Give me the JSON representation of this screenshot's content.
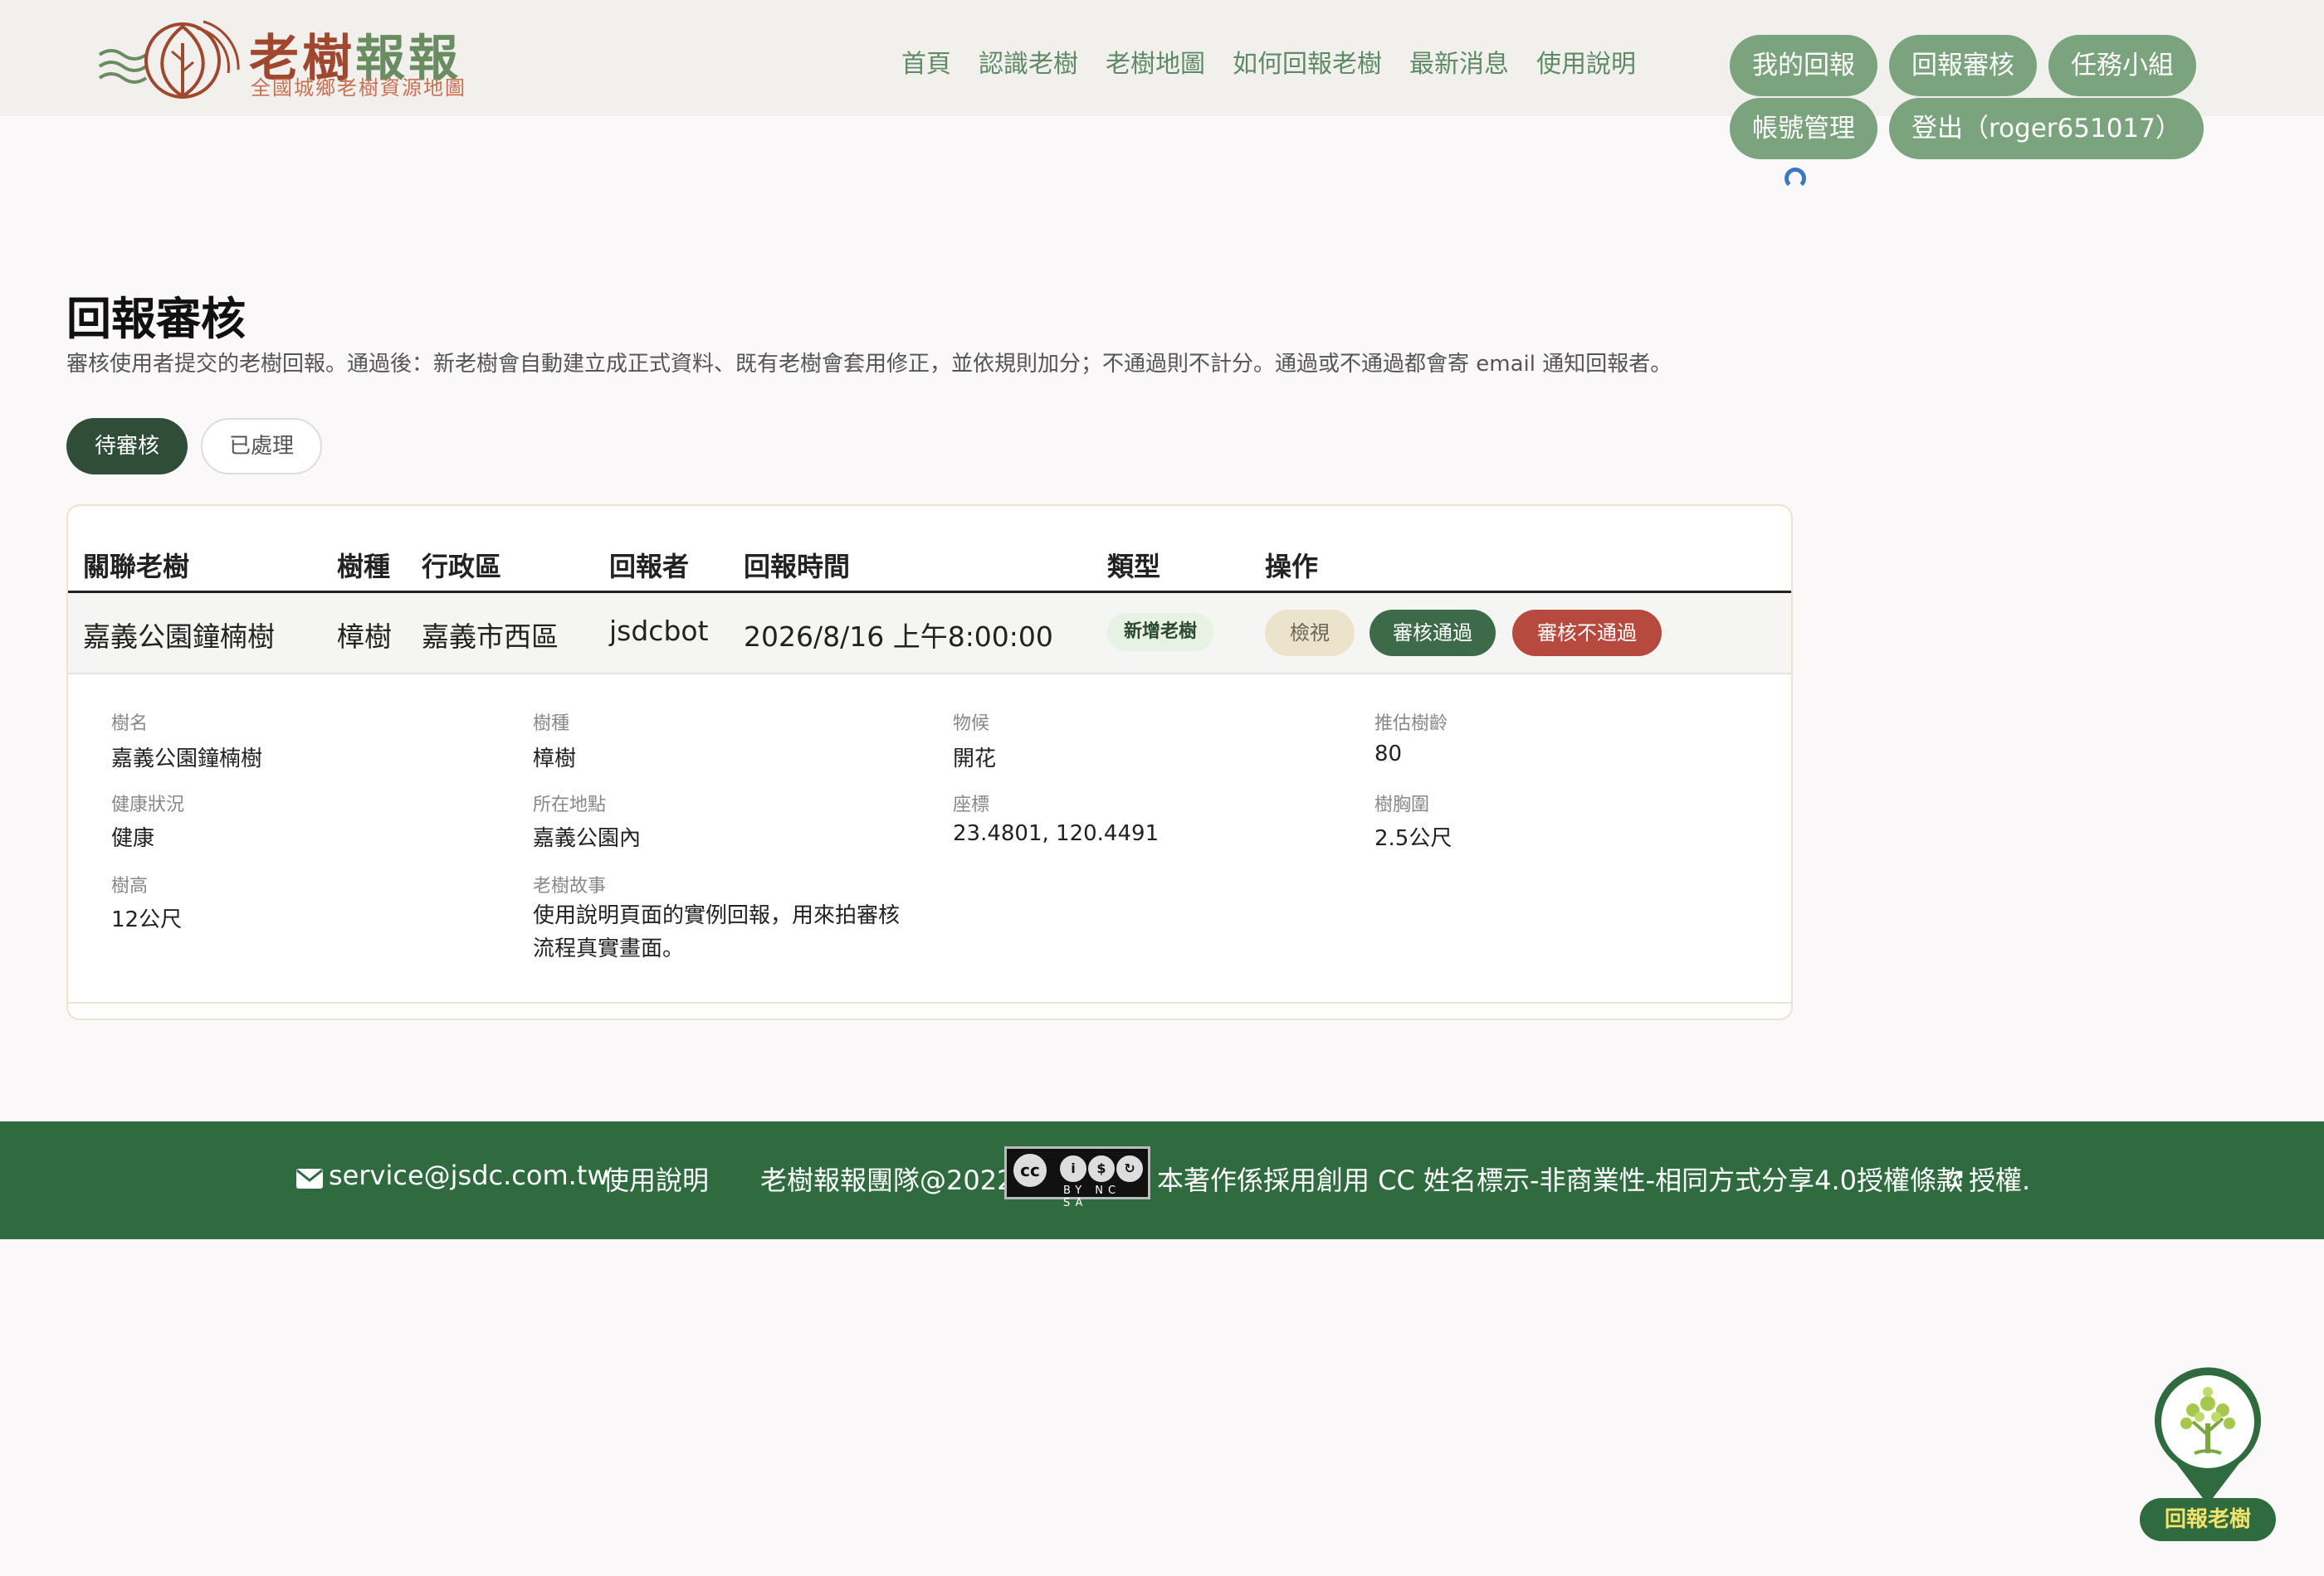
{
  "header": {
    "logo": {
      "title_a": "老樹",
      "title_b": "報報",
      "subtitle": "全國城鄉老樹資源地圖"
    },
    "nav": [
      "首頁",
      "認識老樹",
      "老樹地圖",
      "如何回報老樹",
      "最新消息",
      "使用說明"
    ],
    "pills": {
      "my_reports": "我的回報",
      "review": "回報審核",
      "task_groups": "任務小組",
      "account": "帳號管理",
      "logout": "登出（roger651017）"
    }
  },
  "main": {
    "title": "回報審核",
    "description": "審核使用者提交的老樹回報。通過後：新老樹會自動建立成正式資料、既有老樹會套用修正，並依規則加分；不通過則不計分。通過或不通過都會寄 email 通知回報者。",
    "tabs": {
      "pending": "待審核",
      "done": "已處理"
    },
    "table": {
      "headers": [
        "關聯老樹",
        "樹種",
        "行政區",
        "回報者",
        "回報時間",
        "類型",
        "操作"
      ],
      "row": {
        "tree": "嘉義公園鐘楠樹",
        "species": "樟樹",
        "district": "嘉義市西區",
        "reporter": "jsdcbot",
        "time": "2026/8/16 上午8:00:00",
        "type": "新增老樹",
        "actions": {
          "view": "檢視",
          "approve": "審核通過",
          "reject": "審核不通過"
        }
      },
      "detail": {
        "name_label": "樹名",
        "name": "嘉義公園鐘楠樹",
        "species_label": "樹種",
        "species": "樟樹",
        "phenology_label": "物候",
        "phenology": "開花",
        "age_label": "推估樹齡",
        "age": "80",
        "health_label": "健康狀況",
        "health": "健康",
        "location_label": "所在地點",
        "location": "嘉義公園內",
        "coord_label": "座標",
        "coord": "23.4801, 120.4491",
        "girth_label": "樹胸圍",
        "girth": "2.5公尺",
        "height_label": "樹高",
        "height": "12公尺",
        "story_label": "老樹故事",
        "story": "使用說明頁面的實例回報，用來拍審核流程真實畫面。"
      }
    }
  },
  "footer": {
    "email": "service@jsdc.com.tw",
    "guide": "使用說明",
    "team": "老樹報報團隊@2022",
    "cc_badge_text": "BY NC SA",
    "license_text": "本著作係採用創用 CC 姓名標示-非商業性-相同方式分享4.0授權條款",
    "license_suffix": "授權."
  },
  "float_button": {
    "label": "回報老樹"
  },
  "colors": {
    "header_bg": "#f2f0ed",
    "nav_text": "#5e8a65",
    "pill_bg": "#7ba37e",
    "tab_active": "#2f4d37",
    "approve": "#3d6b4a",
    "reject": "#b74a3e",
    "footer_bg": "#2f6b3f"
  }
}
